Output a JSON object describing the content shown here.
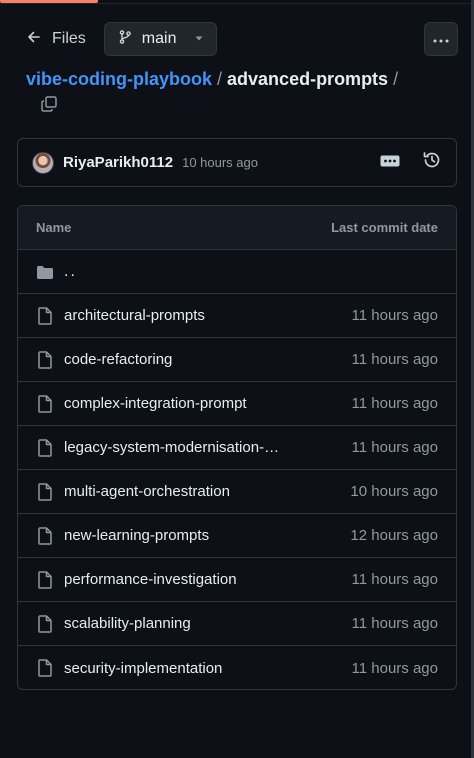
{
  "toolbar": {
    "back_label": "Files",
    "branch": "main"
  },
  "breadcrumb": {
    "repo": "vibe-coding-playbook",
    "separator": "/",
    "folder": "advanced-prompts",
    "trailing": "/"
  },
  "commit": {
    "user": "RiyaParikh0112",
    "time": "10 hours ago"
  },
  "table": {
    "header_name": "Name",
    "header_date": "Last commit date",
    "parent_dir": "..",
    "files": [
      {
        "name": "architectural-prompts",
        "date": "11 hours ago"
      },
      {
        "name": "code-refactoring",
        "date": "11 hours ago"
      },
      {
        "name": "complex-integration-prompt",
        "date": "11 hours ago"
      },
      {
        "name": "legacy-system-modernisation-…",
        "date": "11 hours ago"
      },
      {
        "name": "multi-agent-orchestration",
        "date": "10 hours ago"
      },
      {
        "name": "new-learning-prompts",
        "date": "12 hours ago"
      },
      {
        "name": "performance-investigation",
        "date": "11 hours ago"
      },
      {
        "name": "scalability-planning",
        "date": "11 hours ago"
      },
      {
        "name": "security-implementation",
        "date": "11 hours ago"
      }
    ]
  },
  "colors": {
    "background": "#0d1117",
    "border": "#30363d",
    "link": "#4493f8",
    "muted": "#9198a1",
    "accent": "#f78166"
  },
  "icons": [
    "arrow-left-icon",
    "git-branch-icon",
    "triangle-down-icon",
    "kebab-horizontal-icon",
    "copy-icon",
    "ellipsis-icon",
    "history-icon",
    "folder-icon",
    "file-icon"
  ]
}
